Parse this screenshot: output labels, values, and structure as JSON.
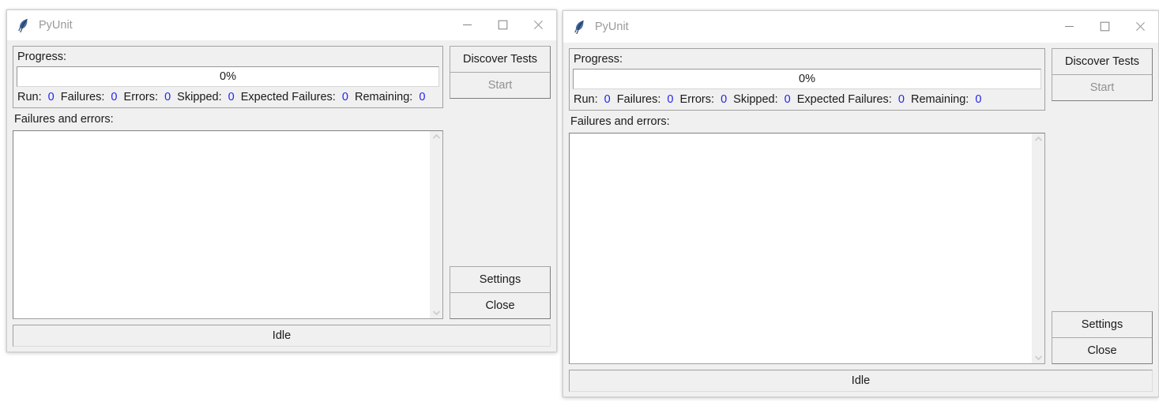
{
  "windows": [
    {
      "title": "PyUnit",
      "icon": "feather-icon",
      "window_controls": {
        "minimize": "minimize-icon",
        "maximize": "maximize-icon",
        "close": "close-icon"
      },
      "progress": {
        "label": "Progress:",
        "percent_text": "0%",
        "percent_value": 0
      },
      "counts": {
        "run_label": "Run:",
        "run_value": "0",
        "failures_label": "Failures:",
        "failures_value": "0",
        "errors_label": "Errors:",
        "errors_value": "0",
        "skipped_label": "Skipped:",
        "skipped_value": "0",
        "expected_failures_label": "Expected Failures:",
        "expected_failures_value": "0",
        "remaining_label": "Remaining:",
        "remaining_value": "0"
      },
      "failures_label": "Failures and errors:",
      "failures_text": "",
      "buttons": {
        "discover": "Discover Tests",
        "start": "Start",
        "settings": "Settings",
        "close": "Close"
      },
      "status": "Idle"
    },
    {
      "title": "PyUnit",
      "icon": "feather-icon",
      "window_controls": {
        "minimize": "minimize-icon",
        "maximize": "maximize-icon",
        "close": "close-icon"
      },
      "progress": {
        "label": "Progress:",
        "percent_text": "0%",
        "percent_value": 0
      },
      "counts": {
        "run_label": "Run:",
        "run_value": "0",
        "failures_label": "Failures:",
        "failures_value": "0",
        "errors_label": "Errors:",
        "errors_value": "0",
        "skipped_label": "Skipped:",
        "skipped_value": "0",
        "expected_failures_label": "Expected Failures:",
        "expected_failures_value": "0",
        "remaining_label": "Remaining:",
        "remaining_value": "0"
      },
      "failures_label": "Failures and errors:",
      "failures_text": "",
      "buttons": {
        "discover": "Discover Tests",
        "start": "Start",
        "settings": "Settings",
        "close": "Close"
      },
      "status": "Idle"
    }
  ],
  "colors": {
    "count_number": "#2424f0",
    "window_background": "#f0f0f0",
    "titlebar": "#ffffff",
    "field_background": "#ffffff",
    "disabled_text": "#919191",
    "title_text": "#9a9a9a",
    "desktop_background": "#ffffff"
  }
}
